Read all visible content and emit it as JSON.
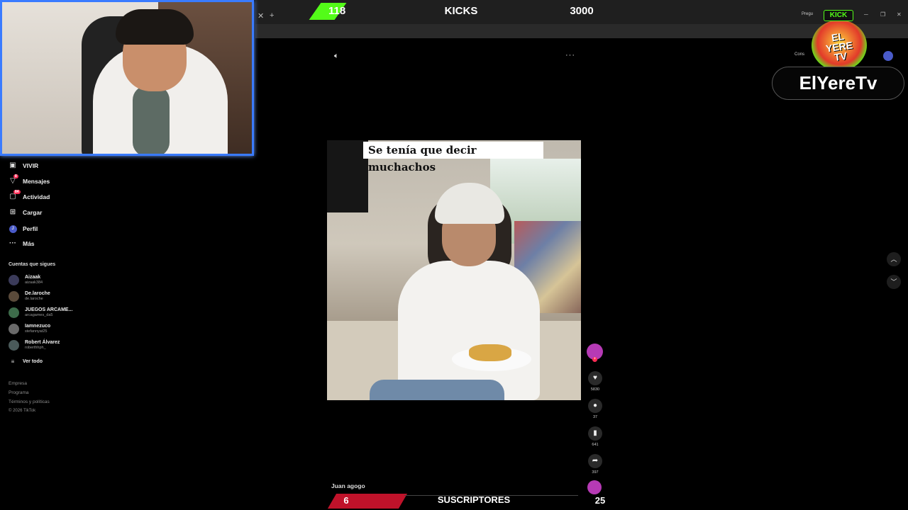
{
  "kick_bar": {
    "count": "118",
    "label": "KICKS",
    "goal": "3000"
  },
  "browser": {
    "close_tab": "✕",
    "new_tab": "+",
    "minimize": "─",
    "restore": "❐",
    "close": "✕",
    "profile_chip": "Pregu",
    "promo_chip": "Cons"
  },
  "sidebar": {
    "items": [
      {
        "label": "VIVIR",
        "icon": "live-icon"
      },
      {
        "label": "Mensajes",
        "icon": "messages-icon",
        "badge": "8"
      },
      {
        "label": "Actividad",
        "icon": "activity-icon",
        "badge": "84"
      },
      {
        "label": "Cargar",
        "icon": "upload-icon"
      },
      {
        "label": "Perfil",
        "icon": "profile-icon",
        "avatar_letter": "J"
      },
      {
        "label": "Más",
        "icon": "more-icon"
      }
    ],
    "following_title": "Cuentas que sigues",
    "accounts": [
      {
        "name": "Aizaak",
        "handle": "aizaak384"
      },
      {
        "name": "De.laroche",
        "handle": "de.laroche"
      },
      {
        "name": "JUEGOS ARCAME...",
        "handle": "arcagames_da5"
      },
      {
        "name": "Iamnezuco",
        "handle": "stefannyat25"
      },
      {
        "name": "Robert Álvarez",
        "handle": "roberthhph_"
      }
    ],
    "see_all": "Ver todo",
    "footer": [
      "Empresa",
      "Programa",
      "Términos y políticas",
      "© 2026 TikTok"
    ]
  },
  "video": {
    "caption": "Se tenía que decir muchachos",
    "author": "Juan agogo"
  },
  "actions": {
    "likes": "5830",
    "comments": "37",
    "saves": "641",
    "shares": "397"
  },
  "overlay": {
    "kick_tag": "KICK",
    "logo_text": "EL YERE TV",
    "channel_name": "ElYereTv"
  },
  "sub_bar": {
    "count": "6",
    "label": "SUSCRIPTORES",
    "goal": "25"
  },
  "colors": {
    "kick_green": "#53fc18",
    "tiktok_red": "#fe2c55",
    "sub_red": "#c0122a",
    "webcam_border": "#3a7bff"
  }
}
